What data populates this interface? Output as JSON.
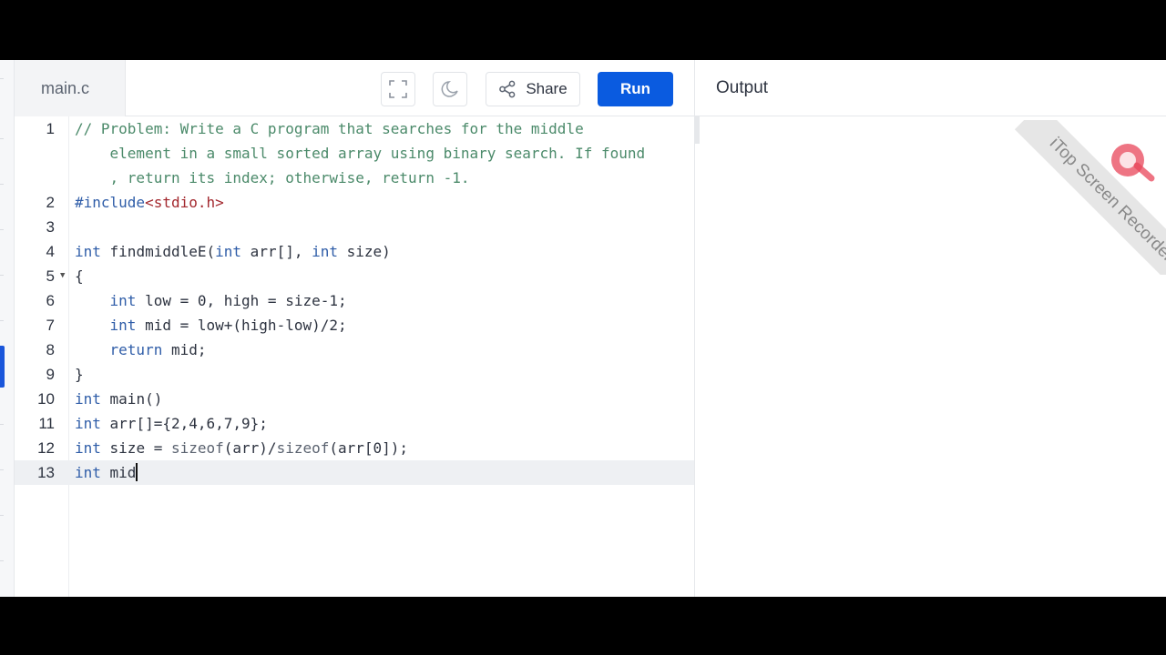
{
  "editor": {
    "filename": "main.c",
    "lines": [
      {
        "num": "1",
        "segments": [
          {
            "t": "// Problem: Write a C program that searches for the middle",
            "c": "comment"
          }
        ]
      },
      {
        "num": "",
        "segments": [
          {
            "t": "    element in a small sorted array using binary search. If found",
            "c": "comment"
          }
        ]
      },
      {
        "num": "",
        "segments": [
          {
            "t": "    , return its index; otherwise, return -1.",
            "c": "comment"
          }
        ]
      },
      {
        "num": "2",
        "segments": [
          {
            "t": "#include",
            "c": "pp"
          },
          {
            "t": "<stdio.h>",
            "c": "str"
          }
        ]
      },
      {
        "num": "3",
        "segments": []
      },
      {
        "num": "4",
        "segments": [
          {
            "t": "int",
            "c": "kw"
          },
          {
            "t": " findmiddleE(",
            "c": ""
          },
          {
            "t": "int",
            "c": "kw"
          },
          {
            "t": " arr[], ",
            "c": ""
          },
          {
            "t": "int",
            "c": "kw"
          },
          {
            "t": " size)",
            "c": ""
          }
        ]
      },
      {
        "num": "5",
        "fold": true,
        "segments": [
          {
            "t": "{",
            "c": ""
          }
        ]
      },
      {
        "num": "6",
        "segments": [
          {
            "t": "    ",
            "c": ""
          },
          {
            "t": "int",
            "c": "kw"
          },
          {
            "t": " low = 0, high = size-1;",
            "c": ""
          }
        ]
      },
      {
        "num": "7",
        "segments": [
          {
            "t": "    ",
            "c": ""
          },
          {
            "t": "int",
            "c": "kw"
          },
          {
            "t": " mid = low+(high-low)/2;",
            "c": ""
          }
        ]
      },
      {
        "num": "8",
        "segments": [
          {
            "t": "    ",
            "c": ""
          },
          {
            "t": "return",
            "c": "kw"
          },
          {
            "t": " mid;",
            "c": ""
          }
        ]
      },
      {
        "num": "9",
        "segments": [
          {
            "t": "}",
            "c": ""
          }
        ]
      },
      {
        "num": "10",
        "segments": [
          {
            "t": "int",
            "c": "kw"
          },
          {
            "t": " main()",
            "c": ""
          }
        ]
      },
      {
        "num": "11",
        "segments": [
          {
            "t": "int",
            "c": "kw"
          },
          {
            "t": " arr[]={2,4,6,7,9};",
            "c": ""
          }
        ]
      },
      {
        "num": "12",
        "segments": [
          {
            "t": "int",
            "c": "kw"
          },
          {
            "t": " size = ",
            "c": ""
          },
          {
            "t": "sizeof",
            "c": "fnc"
          },
          {
            "t": "(arr)/",
            "c": ""
          },
          {
            "t": "sizeof",
            "c": "fnc"
          },
          {
            "t": "(arr[0]);",
            "c": ""
          }
        ]
      },
      {
        "num": "13",
        "active": true,
        "segments": [
          {
            "t": "int",
            "c": "kw"
          },
          {
            "t": " mid",
            "c": ""
          }
        ]
      }
    ]
  },
  "toolbar": {
    "fullscreen_icon": "fullscreen-icon",
    "theme_icon": "moon-icon",
    "share_label": "Share",
    "share_icon": "share-icon",
    "run_label": "Run"
  },
  "output": {
    "title": "Output"
  },
  "watermark": {
    "text": "iTop Screen Recorder"
  },
  "colors": {
    "run_button": "#0a5be0",
    "comment": "#4b8a6a",
    "keyword": "#2f5da8",
    "string": "#a3282e",
    "active_sidebar": "#1a56db"
  }
}
